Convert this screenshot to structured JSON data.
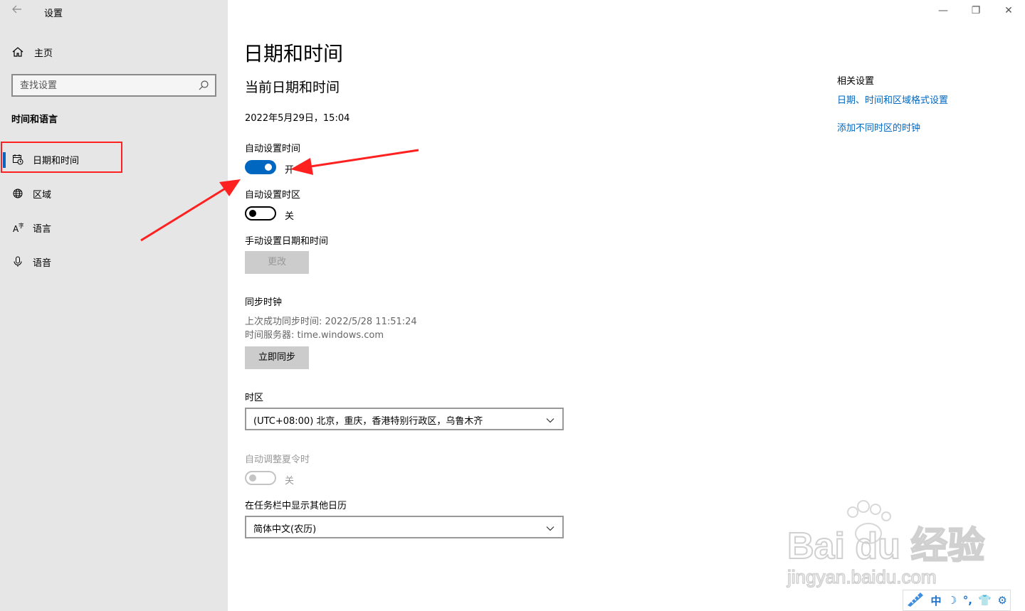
{
  "window": {
    "title": "设置",
    "controls": {
      "minimize": "—",
      "maximize": "❐",
      "close": "✕"
    }
  },
  "sidebar": {
    "home_label": "主页",
    "search_placeholder": "查找设置",
    "section_heading": "时间和语言",
    "items": [
      {
        "label": "日期和时间",
        "icon": "calendar-clock-icon",
        "active": true
      },
      {
        "label": "区域",
        "icon": "globe-icon",
        "active": false
      },
      {
        "label": "语言",
        "icon": "language-icon",
        "active": false
      },
      {
        "label": "语音",
        "icon": "microphone-icon",
        "active": false
      }
    ]
  },
  "main": {
    "title": "日期和时间",
    "subtitle": "当前日期和时间",
    "current_datetime": "2022年5月29日，15:04",
    "auto_time": {
      "label": "自动设置时间",
      "state": "开"
    },
    "auto_timezone": {
      "label": "自动设置时区",
      "state": "关"
    },
    "manual": {
      "label": "手动设置日期和时间",
      "button": "更改"
    },
    "sync": {
      "heading": "同步时钟",
      "last_sync": "上次成功同步时间: 2022/5/28 11:51:24",
      "server": "时间服务器: time.windows.com",
      "button": "立即同步"
    },
    "timezone": {
      "label": "时区",
      "value": "(UTC+08:00) 北京，重庆，香港特别行政区，乌鲁木齐"
    },
    "dst": {
      "label": "自动调整夏令时",
      "state": "关"
    },
    "calendar": {
      "label": "在任务栏中显示其他日历",
      "value": "简体中文(农历)"
    }
  },
  "related": {
    "heading": "相关设置",
    "links": [
      "日期、时间和区域格式设置",
      "添加不同时区的时钟"
    ]
  },
  "watermark": {
    "brand": "Bai du 经验",
    "url": "jingyan.baidu.com"
  },
  "ime": {
    "mode": "中"
  },
  "colors": {
    "accent": "#0067c0",
    "annotation": "#ff2020",
    "sidebar_bg": "#e6e6e6"
  }
}
